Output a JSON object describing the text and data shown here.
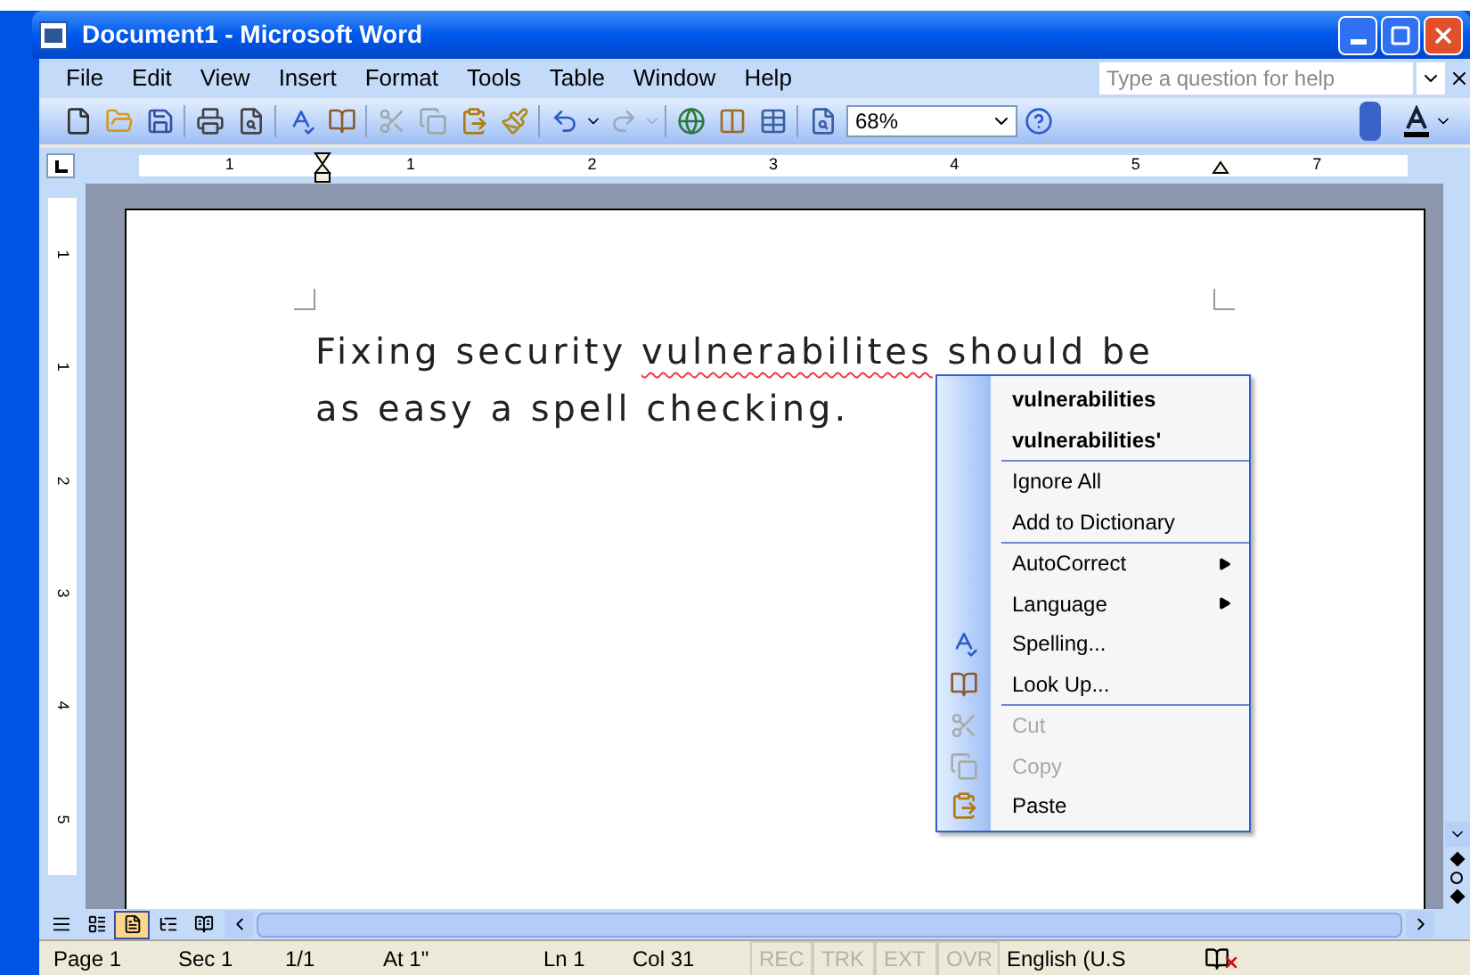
{
  "window": {
    "title": "Document1 - Microsoft Word"
  },
  "menu_bar": [
    "File",
    "Edit",
    "View",
    "Insert",
    "Format",
    "Tools",
    "Table",
    "Window",
    "Help"
  ],
  "help_box": {
    "placeholder": "Type a question for help"
  },
  "zoom_box": {
    "value": "68%"
  },
  "horizontal_ruler": [
    "1",
    "1",
    "2",
    "3",
    "4",
    "5",
    "7"
  ],
  "vertical_ruler": [
    "1",
    "1",
    "2",
    "3",
    "4",
    "5"
  ],
  "document": {
    "lines": [
      {
        "segments": [
          {
            "text": "Fixing security ",
            "misspelled": false
          },
          {
            "text": "vulnerabilites",
            "misspelled": true
          },
          {
            "text": " should be",
            "misspelled": false
          }
        ]
      },
      {
        "segments": [
          {
            "text": "as easy a spell checking.",
            "misspelled": false
          }
        ]
      }
    ]
  },
  "context_menu": {
    "sections": [
      [
        {
          "label": "vulnerabilities",
          "kind": "suggestion",
          "disabled": false,
          "submenu": false
        },
        {
          "label": "vulnerabilities'",
          "kind": "suggestion",
          "disabled": false,
          "submenu": false
        }
      ],
      [
        {
          "label": "Ignore All",
          "kind": "command",
          "disabled": false,
          "submenu": false
        },
        {
          "label": "Add to Dictionary",
          "kind": "command",
          "disabled": false,
          "submenu": false
        }
      ],
      [
        {
          "label": "AutoCorrect",
          "kind": "command",
          "disabled": false,
          "submenu": true
        },
        {
          "label": "Language",
          "kind": "command",
          "disabled": false,
          "submenu": true
        },
        {
          "label": "Spelling...",
          "kind": "command",
          "disabled": false,
          "submenu": false
        },
        {
          "label": "Look Up...",
          "kind": "command",
          "disabled": false,
          "submenu": false
        }
      ],
      [
        {
          "label": "Cut",
          "kind": "command",
          "disabled": true,
          "submenu": false
        },
        {
          "label": "Copy",
          "kind": "command",
          "disabled": true,
          "submenu": false
        },
        {
          "label": "Paste",
          "kind": "command",
          "disabled": false,
          "submenu": false
        }
      ]
    ]
  },
  "view_buttons": [
    {
      "selected": false
    },
    {
      "selected": false
    },
    {
      "selected": true
    },
    {
      "selected": false
    },
    {
      "selected": false
    }
  ],
  "status_bar": [
    {
      "text": "Page 1",
      "enabled": true
    },
    {
      "text": "Sec 1",
      "enabled": true
    },
    {
      "text": "1/1",
      "enabled": true
    },
    {
      "text": "At 1\"",
      "enabled": true
    },
    {
      "text": "Ln 1",
      "enabled": true
    },
    {
      "text": "Col 31",
      "enabled": true
    },
    {
      "text": "REC",
      "enabled": false
    },
    {
      "text": "TRK",
      "enabled": false
    },
    {
      "text": "EXT",
      "enabled": false
    },
    {
      "text": "OVR",
      "enabled": false
    },
    {
      "text": "English (U.S",
      "enabled": true
    }
  ]
}
